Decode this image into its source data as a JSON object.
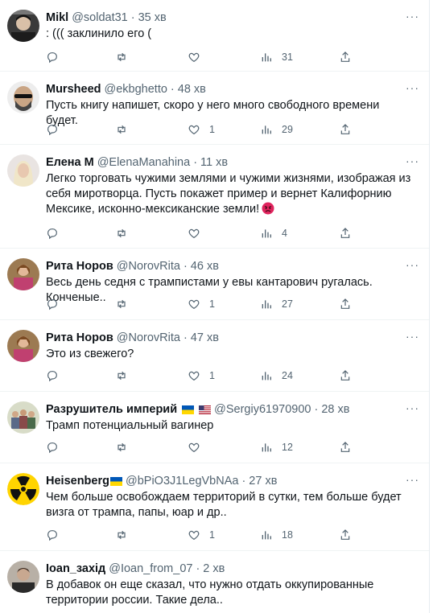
{
  "tweets": [
    {
      "name": "Mikl",
      "handle": "@soldat31",
      "time": "35 хв",
      "text": ": ((( заклинило его (",
      "likes": "",
      "views": "31"
    },
    {
      "name": "Mursheed",
      "handle": "@ekbghetto",
      "time": "48 хв",
      "text": "Пусть книгу напишет, скоро у него много свободного времени будет.",
      "likes": "1",
      "views": "29"
    },
    {
      "name": "Елена М",
      "handle": "@ElenaManahina",
      "time": "11 хв",
      "text": "Легко торговать чужими землями и чужими жизнями, изображая из себя миротворца. Пусть покажет пример и вернет Калифорнию Мексике, исконно-мексиканские земли!",
      "emoji": "angry-face",
      "likes": "",
      "views": "4"
    },
    {
      "name": "Рита Норов",
      "handle": "@NorovRita",
      "time": "46 хв",
      "text": "Весь день седня с трампистами у евы кантарович ругалась. Конченые..",
      "likes": "1",
      "views": "27"
    },
    {
      "name": "Рита Норов",
      "handle": "@NorovRita",
      "time": "47 хв",
      "text": "Это из свежего?",
      "likes": "1",
      "views": "24"
    },
    {
      "name": "Разрушитель империй",
      "handle": "@Sergiy61970900",
      "time": "28 хв",
      "text": "Трамп потенциальный вагинер",
      "flags": [
        "ukraine-flag",
        "usa-flag"
      ],
      "likes": "",
      "views": "12"
    },
    {
      "name": "Heisenberg",
      "handle": "@bPiO3J1LegVbNAa",
      "time": "27 хв",
      "text": "Чем больше освобождаем территорий в сутки, тем больше будет визга от трампа, папы, юар и др..",
      "flags": [
        "ukraine-flag"
      ],
      "likes": "1",
      "views": "18"
    },
    {
      "name": "Ioan_захід",
      "handle": "@Ioan_from_07",
      "time": "2 хв",
      "text": "В добавок он еще сказал, что нужно отдать оккупированные территории россии. Такие дела..",
      "likes": "",
      "views": ""
    }
  ],
  "colors": {
    "text": "#0f1419",
    "muted": "#536471",
    "divider": "#eff3f4",
    "ukraine_blue": "#0057b7",
    "ukraine_yellow": "#ffd700"
  }
}
